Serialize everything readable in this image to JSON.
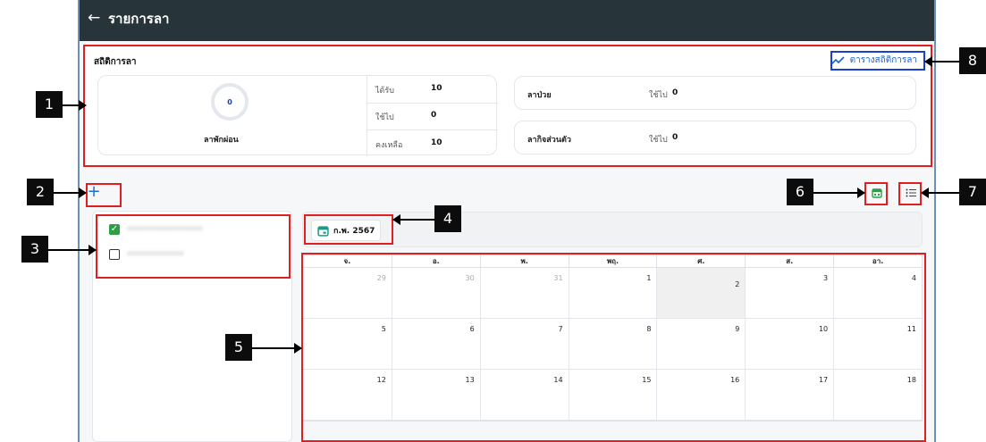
{
  "header": {
    "title": "รายการลา",
    "back_icon": "arrow-left-icon"
  },
  "stats": {
    "title": "สถิติการลา",
    "chart_link_label": "ตารางสถิติการลา",
    "chart_link_icon": "trend-line-icon",
    "vacation": {
      "label": "ลาพักผ่อน",
      "ring_value": "0",
      "rows": [
        {
          "label": "ได้รับ",
          "value": "10"
        },
        {
          "label": "ใช้ไป",
          "value": "0"
        },
        {
          "label": "คงเหลือ",
          "value": "10"
        }
      ]
    },
    "sick": {
      "label": "ลาป่วย",
      "used_label": "ใช้ไป",
      "used_value": "0"
    },
    "personal": {
      "label": "ลากิจส่วนตัว",
      "used_label": "ใช้ไป",
      "used_value": "0"
    }
  },
  "toolbar": {
    "add_icon": "plus-icon",
    "calendar_view_icon": "calendar-icon",
    "list_view_icon": "list-icon"
  },
  "filters": [
    {
      "label": "••••••••••••••••",
      "checked": true
    },
    {
      "label": "••••••••••••",
      "checked": false
    }
  ],
  "calendar": {
    "month_label": "ก.พ. 2567",
    "weekdays": [
      "จ.",
      "อ.",
      "พ.",
      "พฤ.",
      "ศ.",
      "ส.",
      "อา."
    ],
    "weeks": [
      [
        "29",
        "30",
        "31",
        "1",
        "2",
        "3",
        "4"
      ],
      [
        "5",
        "6",
        "7",
        "8",
        "9",
        "10",
        "11"
      ],
      [
        "12",
        "13",
        "14",
        "15",
        "16",
        "17",
        "18"
      ]
    ]
  },
  "annotations": {
    "callout_1": "1",
    "callout_2": "2",
    "callout_3": "3",
    "callout_4": "4",
    "callout_5": "5",
    "callout_6": "6",
    "callout_7": "7",
    "callout_8": "8"
  },
  "colors": {
    "accent": "#1a6fd0",
    "topbar": "#27343a",
    "check": "#2e9e47",
    "annotation": "#e02020"
  }
}
